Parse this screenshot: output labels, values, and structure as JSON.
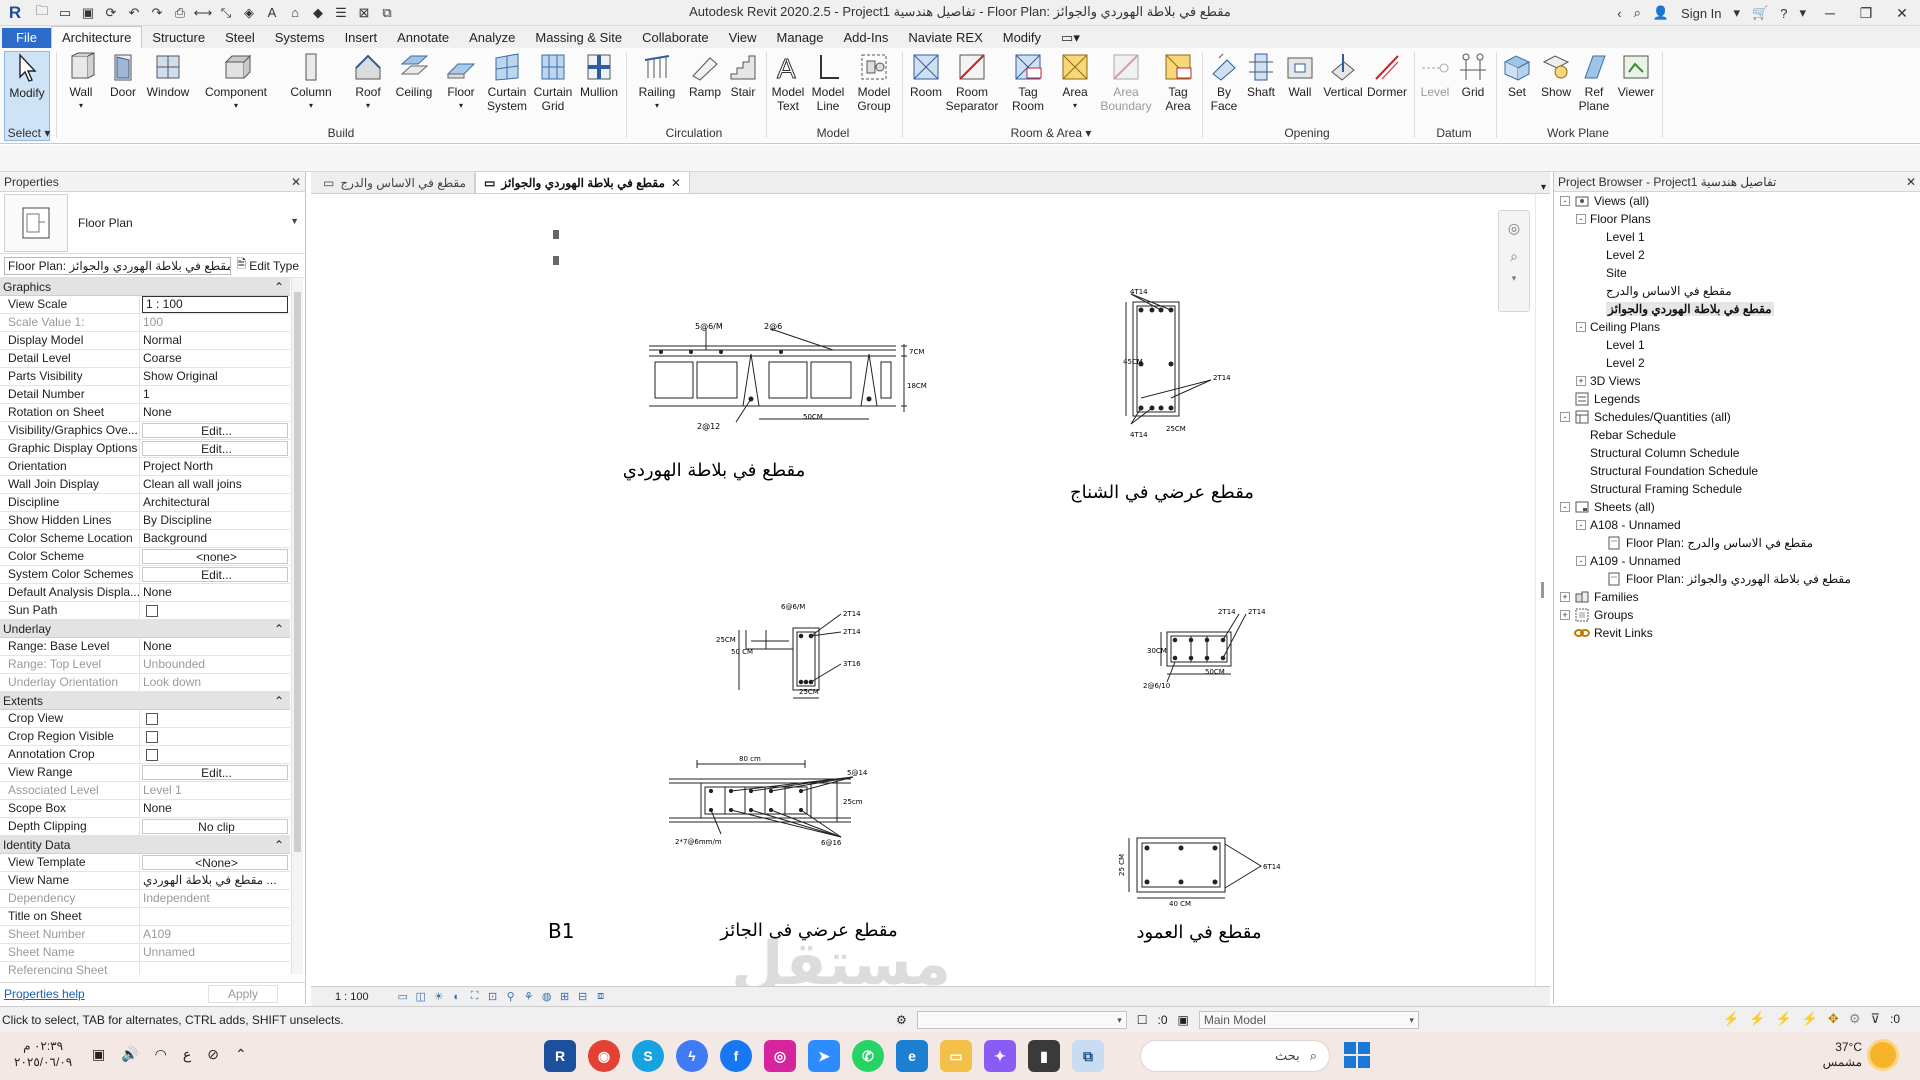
{
  "titlebar": {
    "title": "Autodesk Revit 2020.2.5 - Project1    تفاصيل هندسية - Floor Plan: مقطع في بلاطة الهوردي والجوائز",
    "sign_in": "Sign In"
  },
  "ribbon_tabs": [
    "File",
    "Architecture",
    "Structure",
    "Steel",
    "Systems",
    "Insert",
    "Annotate",
    "Analyze",
    "Massing & Site",
    "Collaborate",
    "View",
    "Manage",
    "Add-Ins",
    "Naviate REX",
    "Modify"
  ],
  "ribbon": {
    "buttons": {
      "modify": "Modify",
      "wall": "Wall",
      "door": "Door",
      "window": "Window",
      "component": "Component",
      "column": "Column",
      "roof": "Roof",
      "ceiling": "Ceiling",
      "floor": "Floor",
      "curtain_system_1": "Curtain",
      "curtain_system_2": "System",
      "curtain_grid_1": "Curtain",
      "curtain_grid_2": "Grid",
      "mullion": "Mullion",
      "railing": "Railing",
      "ramp": "Ramp",
      "stair": "Stair",
      "model_text_1": "Model",
      "model_text_2": "Text",
      "model_line_1": "Model",
      "model_line_2": "Line",
      "model_group_1": "Model",
      "model_group_2": "Group",
      "room": "Room",
      "room_sep_1": "Room",
      "room_sep_2": "Separator",
      "tag_room_1": "Tag",
      "tag_room_2": "Room",
      "area": "Area",
      "area_boundary_1": "Area",
      "area_boundary_2": "Boundary",
      "tag_area_1": "Tag",
      "tag_area_2": "Area",
      "by_face_1": "By",
      "by_face_2": "Face",
      "shaft": "Shaft",
      "op_wall": "Wall",
      "vertical": "Vertical",
      "dormer": "Dormer",
      "level": "Level",
      "grid": "Grid",
      "set": "Set",
      "show": "Show",
      "ref_plane_1": "Ref",
      "ref_plane_2": "Plane",
      "viewer": "Viewer"
    },
    "panels": {
      "select": "Select",
      "build": "Build",
      "circulation": "Circulation",
      "model": "Model",
      "room_area": "Room & Area",
      "opening": "Opening",
      "datum": "Datum",
      "work_plane": "Work Plane"
    }
  },
  "properties": {
    "header": "Properties",
    "type_name": "Floor Plan",
    "instance_selector": "Floor Plan: مقطع في بلاطة الهوردي والجوائز",
    "edit_type": "Edit Type",
    "groups": [
      {
        "name": "Graphics",
        "rows": [
          {
            "k": "View Scale",
            "v": "1 : 100",
            "kind": "boxed"
          },
          {
            "k": "Scale Value    1:",
            "v": "100",
            "kind": "ro"
          },
          {
            "k": "Display Model",
            "v": "Normal"
          },
          {
            "k": "Detail Level",
            "v": "Coarse"
          },
          {
            "k": "Parts Visibility",
            "v": "Show Original"
          },
          {
            "k": "Detail Number",
            "v": "1"
          },
          {
            "k": "Rotation on Sheet",
            "v": "None"
          },
          {
            "k": "Visibility/Graphics Ove...",
            "v": "Edit...",
            "kind": "btn"
          },
          {
            "k": "Graphic Display Options",
            "v": "Edit...",
            "kind": "btn"
          },
          {
            "k": "Orientation",
            "v": "Project North"
          },
          {
            "k": "Wall Join Display",
            "v": "Clean all wall joins"
          },
          {
            "k": "Discipline",
            "v": "Architectural"
          },
          {
            "k": "Show Hidden Lines",
            "v": "By Discipline"
          },
          {
            "k": "Color Scheme Location",
            "v": "Background"
          },
          {
            "k": "Color Scheme",
            "v": "<none>",
            "kind": "btn"
          },
          {
            "k": "System Color Schemes",
            "v": "Edit...",
            "kind": "btn"
          },
          {
            "k": "Default Analysis Displa...",
            "v": "None"
          },
          {
            "k": "Sun Path",
            "v": "",
            "kind": "chk"
          }
        ]
      },
      {
        "name": "Underlay",
        "rows": [
          {
            "k": "Range: Base Level",
            "v": "None"
          },
          {
            "k": "Range: Top Level",
            "v": "Unbounded",
            "kind": "ro"
          },
          {
            "k": "Underlay Orientation",
            "v": "Look down",
            "kind": "ro"
          }
        ]
      },
      {
        "name": "Extents",
        "rows": [
          {
            "k": "Crop View",
            "v": "",
            "kind": "chk"
          },
          {
            "k": "Crop Region Visible",
            "v": "",
            "kind": "chk"
          },
          {
            "k": "Annotation Crop",
            "v": "",
            "kind": "chk"
          },
          {
            "k": "View Range",
            "v": "Edit...",
            "kind": "btn"
          },
          {
            "k": "Associated Level",
            "v": "Level 1",
            "kind": "ro"
          },
          {
            "k": "Scope Box",
            "v": "None"
          },
          {
            "k": "Depth Clipping",
            "v": "No clip",
            "kind": "btn"
          }
        ]
      },
      {
        "name": "Identity Data",
        "rows": [
          {
            "k": "View Template",
            "v": "<None>",
            "kind": "btn"
          },
          {
            "k": "View Name",
            "v": "مقطع في بلاطة الهوردي ..."
          },
          {
            "k": "Dependency",
            "v": "Independent",
            "kind": "ro"
          },
          {
            "k": "Title on Sheet",
            "v": ""
          },
          {
            "k": "Sheet Number",
            "v": "A109",
            "kind": "ro"
          },
          {
            "k": "Sheet Name",
            "v": "Unnamed",
            "kind": "ro"
          },
          {
            "k": "Referencing Sheet",
            "v": "",
            "kind": "ro"
          }
        ]
      }
    ],
    "help_link": "Properties help",
    "apply": "Apply"
  },
  "view_tabs": [
    {
      "label": "مقطع في الاساس والدرج",
      "active": false
    },
    {
      "label": "مقطع في بلاطة الهوردي والجوائز",
      "active": true
    }
  ],
  "drawing": {
    "hordi": {
      "title": "مقطع في بلاطة الهوردي",
      "l1": "5@6/M",
      "l2": "2@6",
      "l3": "2@12",
      "d1": "7CM",
      "d2": "18CM",
      "d3": "50CM"
    },
    "shnaj": {
      "title": "مقطع عرضي في الشناج",
      "top": "4T14",
      "side": "2T14",
      "bot": "4T14",
      "h": "45CM",
      "w": "25CM"
    },
    "edge": {
      "l1": "6@6/M",
      "l2": "2T14",
      "l3": "2T14",
      "l4": "3T16",
      "h1": "25CM",
      "h2": "50 CM",
      "w": "25CM"
    },
    "beam2": {
      "l1": "2T14",
      "l2": "2T14",
      "h": "30CM",
      "st": "2@6/10",
      "w": "50CM"
    },
    "girder": {
      "title": "مقطع عرضي في الجائز",
      "code": "B1",
      "w": "80 cm",
      "top": "5@14",
      "h": "25cm",
      "st": "2*7@6mm/m",
      "bot": "6@16"
    },
    "column": {
      "title": "مقطع في العمود",
      "bars": "6T14",
      "h": "25 CM",
      "w": "40 CM"
    }
  },
  "view_control": {
    "scale": "1 : 100"
  },
  "browser": {
    "header": "Project Browser - Project1    تفاصيل هندسية",
    "nodes": [
      {
        "label": "Views (all)",
        "level": 0,
        "toggle": "-",
        "icon": "views"
      },
      {
        "label": "Floor Plans",
        "level": 1,
        "toggle": "-"
      },
      {
        "label": "Level 1",
        "level": 2
      },
      {
        "label": "Level 2",
        "level": 2
      },
      {
        "label": "Site",
        "level": 2
      },
      {
        "label": "مقطع في الاساس والدرج",
        "level": 2
      },
      {
        "label": "مقطع في بلاطة الهوردي والجوائز",
        "level": 2,
        "selected": true
      },
      {
        "label": "Ceiling Plans",
        "level": 1,
        "toggle": "-"
      },
      {
        "label": "Level 1",
        "level": 2
      },
      {
        "label": "Level 2",
        "level": 2
      },
      {
        "label": "3D Views",
        "level": 1,
        "toggle": "+"
      },
      {
        "label": "Legends",
        "level": 0,
        "icon": "legend"
      },
      {
        "label": "Schedules/Quantities (all)",
        "level": 0,
        "toggle": "-",
        "icon": "schedule"
      },
      {
        "label": "Rebar Schedule",
        "level": 1
      },
      {
        "label": "Structural Column Schedule",
        "level": 1
      },
      {
        "label": "Structural Foundation Schedule",
        "level": 1
      },
      {
        "label": "Structural Framing Schedule",
        "level": 1
      },
      {
        "label": "Sheets (all)",
        "level": 0,
        "toggle": "-",
        "icon": "sheet"
      },
      {
        "label": "A108 - Unnamed",
        "level": 1,
        "toggle": "-"
      },
      {
        "label": "Floor Plan: مقطع في الاساس والدرج",
        "level": 2,
        "icon": "sheetview"
      },
      {
        "label": "A109 - Unnamed",
        "level": 1,
        "toggle": "-"
      },
      {
        "label": "Floor Plan: مقطع في بلاطة الهوردي والجوائز",
        "level": 2,
        "icon": "sheetview"
      },
      {
        "label": "Families",
        "level": 0,
        "toggle": "+",
        "icon": "family"
      },
      {
        "label": "Groups",
        "level": 0,
        "toggle": "+",
        "icon": "group"
      },
      {
        "label": "Revit Links",
        "level": 0,
        "icon": "link"
      }
    ]
  },
  "statusbar": {
    "hint": "Click to select, TAB for alternates, CTRL adds, SHIFT unselects.",
    "active_count": ":0",
    "model": "Main Model",
    "filter_count": ":0"
  },
  "taskbar": {
    "time": "٠٢:٣٩ م",
    "date": "٢٠٢٥/٠٦/٠٩",
    "lang": "ع",
    "search": "بحث",
    "temp": "37°C",
    "weather": "مشمس"
  }
}
